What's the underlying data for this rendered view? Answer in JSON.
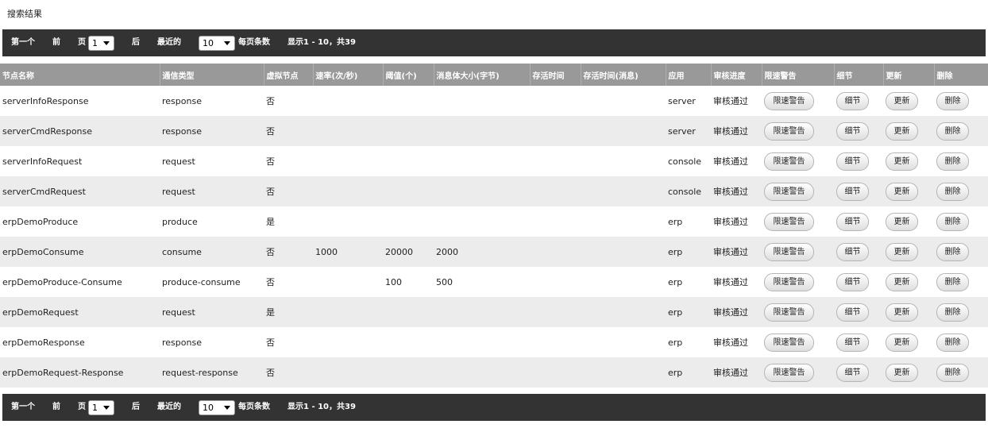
{
  "page_title": "搜索结果",
  "pager": {
    "first": "第一个",
    "prev": "前",
    "page_label": "页",
    "page_value": "1",
    "next": "后",
    "last": "最近的",
    "per_page_value": "10",
    "per_page_label": "每页条数",
    "summary": "显示1 - 10，共39"
  },
  "table": {
    "columns": [
      "节点名称",
      "通信类型",
      "虚拟节点",
      "速率(次/秒)",
      "阈值(个)",
      "消息体大小(字节)",
      "存活时间",
      "存活时间(消息)",
      "应用",
      "审核进度",
      "限速警告",
      "细节",
      "更新",
      "删除"
    ],
    "buttons": {
      "warn": "限速警告",
      "detail": "细节",
      "update": "更新",
      "delete": "删除"
    },
    "rows": [
      {
        "name": "serverInfoResponse",
        "type": "response",
        "virtual": "否",
        "rate": "",
        "threshold": "",
        "size": "",
        "ttl": "",
        "ttl_msg": "",
        "app": "server",
        "status": "审核通过"
      },
      {
        "name": "serverCmdResponse",
        "type": "response",
        "virtual": "否",
        "rate": "",
        "threshold": "",
        "size": "",
        "ttl": "",
        "ttl_msg": "",
        "app": "server",
        "status": "审核通过"
      },
      {
        "name": "serverInfoRequest",
        "type": "request",
        "virtual": "否",
        "rate": "",
        "threshold": "",
        "size": "",
        "ttl": "",
        "ttl_msg": "",
        "app": "console",
        "status": "审核通过"
      },
      {
        "name": "serverCmdRequest",
        "type": "request",
        "virtual": "否",
        "rate": "",
        "threshold": "",
        "size": "",
        "ttl": "",
        "ttl_msg": "",
        "app": "console",
        "status": "审核通过"
      },
      {
        "name": "erpDemoProduce",
        "type": "produce",
        "virtual": "是",
        "rate": "",
        "threshold": "",
        "size": "",
        "ttl": "",
        "ttl_msg": "",
        "app": "erp",
        "status": "审核通过"
      },
      {
        "name": "erpDemoConsume",
        "type": "consume",
        "virtual": "否",
        "rate": "1000",
        "threshold": "20000",
        "size": "2000",
        "ttl": "",
        "ttl_msg": "",
        "app": "erp",
        "status": "审核通过"
      },
      {
        "name": "erpDemoProduce-Consume",
        "type": "produce-consume",
        "virtual": "否",
        "rate": "",
        "threshold": "100",
        "size": "500",
        "ttl": "",
        "ttl_msg": "",
        "app": "erp",
        "status": "审核通过"
      },
      {
        "name": "erpDemoRequest",
        "type": "request",
        "virtual": "是",
        "rate": "",
        "threshold": "",
        "size": "",
        "ttl": "",
        "ttl_msg": "",
        "app": "erp",
        "status": "审核通过"
      },
      {
        "name": "erpDemoResponse",
        "type": "response",
        "virtual": "否",
        "rate": "",
        "threshold": "",
        "size": "",
        "ttl": "",
        "ttl_msg": "",
        "app": "erp",
        "status": "审核通过"
      },
      {
        "name": "erpDemoRequest-Response",
        "type": "request-response",
        "virtual": "否",
        "rate": "",
        "threshold": "",
        "size": "",
        "ttl": "",
        "ttl_msg": "",
        "app": "erp",
        "status": "审核通过"
      }
    ]
  }
}
